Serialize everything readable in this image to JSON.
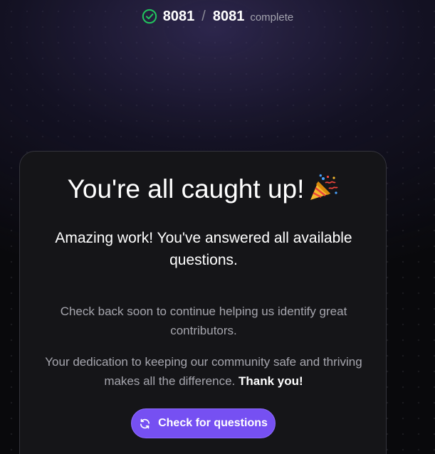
{
  "progress": {
    "completed": "8081",
    "separator": "/",
    "total": "8081",
    "status": "complete",
    "icon": "check-circle-icon"
  },
  "card": {
    "headline": "You're all caught up!",
    "headline_icon": "party-popper-icon",
    "subhead": "Amazing work! You've answered all available questions.",
    "info_1": "Check back soon to continue helping us identify great contributors.",
    "info_2": "Your dedication to keeping our community safe and thriving makes all the difference.",
    "info_2_emphasis": "Thank you!",
    "button_label": "Check for questions",
    "button_icon": "refresh-icon"
  },
  "colors": {
    "accent": "#7650f2",
    "success": "#22c55e",
    "card_background": "#151518",
    "page_background": "#09090c"
  }
}
